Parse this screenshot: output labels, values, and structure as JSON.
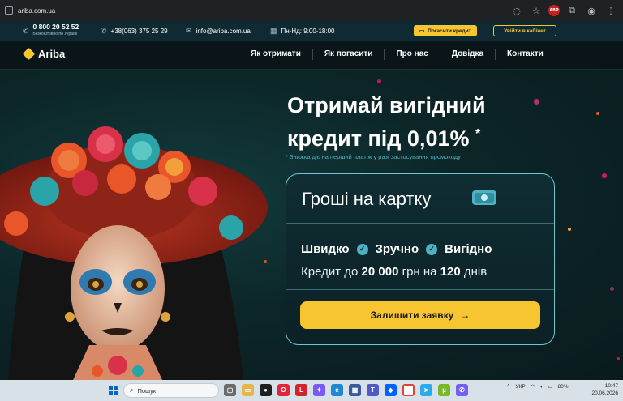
{
  "browser": {
    "url": "ariba.com.ua",
    "extension_badge": "ABP"
  },
  "infobar": {
    "free_phone": "0 800 20 52 52",
    "free_phone_note": "Безкоштовно по Україні",
    "mobile_phone": "+38(063) 375 25 29",
    "email": "info@ariba.com.ua",
    "hours": "Пн-Нд: 9:00-18:00",
    "pay_button": "Погасити кредит",
    "login_button": "Увійти в кабінет"
  },
  "nav": {
    "logo": "Ariba",
    "links": [
      "Як отримати",
      "Як погасити",
      "Про нас",
      "Довідка",
      "Контакти"
    ]
  },
  "hero": {
    "title_line1": "Отримай вигідний",
    "title_line2": "кредит під 0,01%",
    "title_star": "*",
    "note": "* Знижка діє на перший платіж у разі застосування промокоду",
    "card": {
      "title": "Гроші на картку",
      "features": [
        "Швидко",
        "Зручно",
        "Вигідно"
      ],
      "credit_prefix": "Кредит до",
      "credit_amount": "20 000",
      "credit_mid": "грн на",
      "credit_days": "120",
      "credit_suffix": "днів",
      "apply_button": "Залишити заявку"
    }
  },
  "taskbar": {
    "search_placeholder": "Пошук",
    "apps": [
      "files",
      "edge-o",
      "opera",
      "L",
      "copilot",
      "edge",
      "store",
      "teams",
      "dropbox",
      "chrome",
      "telegram",
      "utorrent",
      "viber"
    ],
    "language": "УКР",
    "battery": "80%",
    "time": "10:47",
    "date": "20.06.2026"
  },
  "colors": {
    "accent": "#f7c530",
    "teal": "#4fb2c4",
    "bg": "#0b1a1f"
  }
}
